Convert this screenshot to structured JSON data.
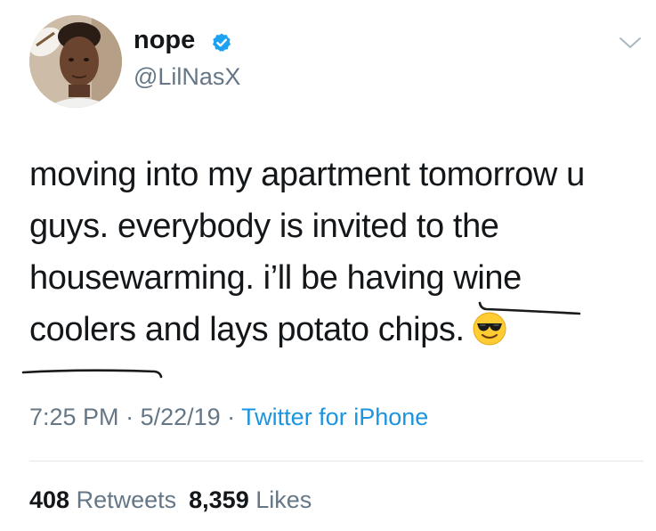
{
  "author": {
    "display_name": "nope",
    "handle": "@LilNasX",
    "verified": true,
    "avatar_icon": "profile-photo"
  },
  "tweet": {
    "lines": [
      "moving into my apartment tomorrow u",
      "guys. everybody is invited to the",
      "housewarming. i’ll be having wine",
      "coolers and lays potato chips."
    ],
    "emoji": "smiling-face-with-sunglasses"
  },
  "meta": {
    "time": "7:25 PM",
    "sep1": " · ",
    "date": "5/22/19",
    "sep2": " · ",
    "source": "Twitter for iPhone"
  },
  "stats": {
    "retweets_count": "408",
    "retweets_label": "Retweets",
    "likes_count": "8,359",
    "likes_label": "Likes"
  },
  "colors": {
    "text": "#14171a",
    "secondary": "#657786",
    "link": "#1b95e0",
    "verified": "#1da1f2",
    "divider": "#e1e8ed"
  }
}
